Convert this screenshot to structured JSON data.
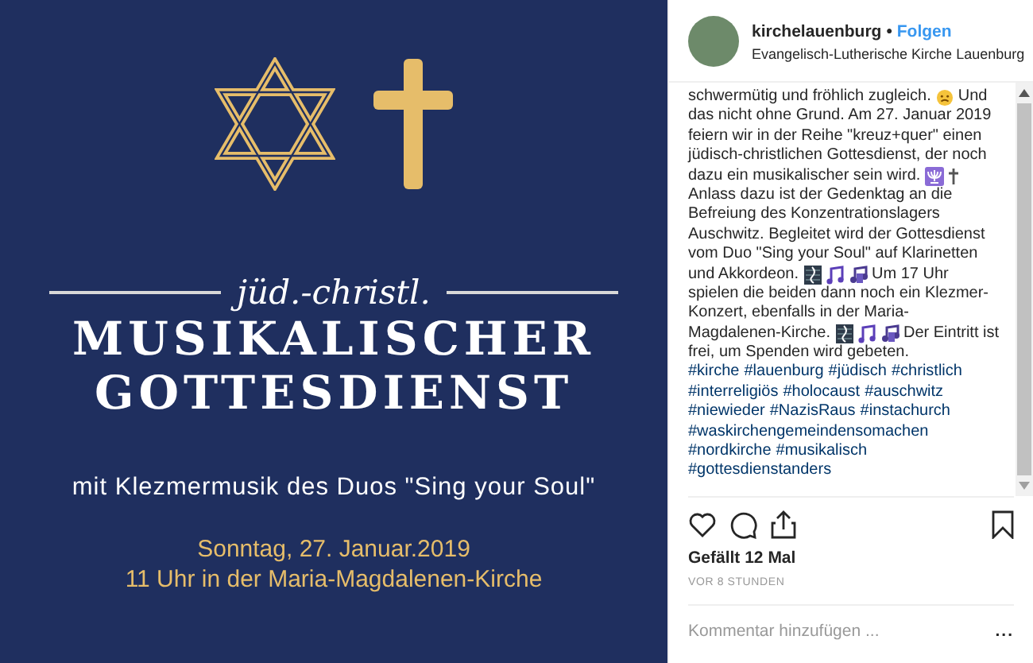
{
  "poster": {
    "subtitle": "jüd.-christl.",
    "title_lines": [
      "MUSIKALISCHER",
      "GOTTESDIENST"
    ],
    "tagline": "mit Klezmermusik des Duos \"Sing your Soul\"",
    "date": "Sonntag, 27. Januar.2019",
    "place": "11 Uhr in der Maria-Magdalenen-Kirche"
  },
  "header": {
    "username": "kirchelauenburg",
    "separator": "•",
    "follow": "Folgen",
    "location": "Evangelisch-Lutherische Kirche Lauenburg"
  },
  "caption_lines": [
    [
      {
        "kind": "text",
        "text": "schwermütig und fröhlich zugleich."
      },
      {
        "kind": "sad-face"
      },
      {
        "kind": "text",
        "text": "Und"
      }
    ],
    [
      {
        "kind": "text",
        "text": "das nicht ohne Grund. Am 27. Januar 2019"
      }
    ],
    [
      {
        "kind": "text",
        "text": "feiern wir in der Reihe \"kreuz+quer\" einen"
      }
    ],
    [
      {
        "kind": "text",
        "text": "jüdisch-christlichen Gottesdienst, der noch"
      }
    ],
    [
      {
        "kind": "text",
        "text": "dazu ein musikalischer sein wird."
      },
      {
        "kind": "menorah"
      },
      {
        "kind": "cross"
      }
    ],
    [
      {
        "kind": "text",
        "text": "Anlass dazu ist der Gedenktag an die"
      }
    ],
    [
      {
        "kind": "text",
        "text": "Befreiung des Konzentrationslagers"
      }
    ],
    [
      {
        "kind": "text",
        "text": "Auschwitz. Begleitet wird der Gottesdienst"
      }
    ],
    [
      {
        "kind": "text",
        "text": "vom Duo \"Sing your Soul\" auf Klarinetten"
      }
    ],
    [
      {
        "kind": "text",
        "text": "und Akkordeon."
      },
      {
        "kind": "music-score"
      },
      {
        "kind": "music-note"
      },
      {
        "kind": "music-notes"
      },
      {
        "kind": "text",
        "text": "Um 17 Uhr"
      }
    ],
    [
      {
        "kind": "text",
        "text": "spielen die beiden dann noch ein Klezmer-"
      }
    ],
    [
      {
        "kind": "text",
        "text": "Konzert, ebenfalls in der Maria-"
      }
    ],
    [
      {
        "kind": "text",
        "text": "Magdalenen-Kirche."
      },
      {
        "kind": "music-score"
      },
      {
        "kind": "music-note"
      },
      {
        "kind": "music-notes"
      },
      {
        "kind": "text",
        "text": "Der Eintritt ist"
      }
    ],
    [
      {
        "kind": "text",
        "text": "frei, um Spenden wird gebeten."
      }
    ]
  ],
  "hashtag_lines": [
    [
      "#kirche",
      "#lauenburg",
      "#jüdisch",
      "#christlich"
    ],
    [
      "#interreligiös",
      "#holocaust",
      "#auschwitz"
    ],
    [
      "#niewieder",
      "#NazisRaus",
      "#instachurch"
    ],
    [
      "#waskirchengemeindensomachen"
    ],
    [
      "#nordkirche",
      "#musikalisch"
    ],
    [
      "#gottesdienstanders"
    ]
  ],
  "likes": "Gefällt 12 Mal",
  "time": "VOR 8 STUNDEN",
  "comment": {
    "placeholder": "Kommentar hinzufügen ...",
    "more": "..."
  }
}
